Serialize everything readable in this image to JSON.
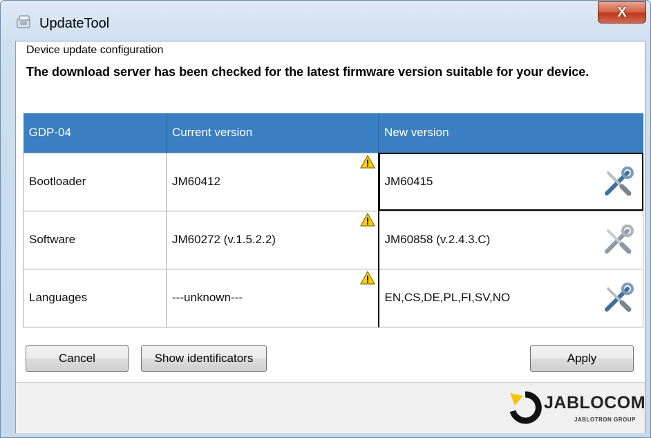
{
  "window": {
    "title": "UpdateTool",
    "close_label": "X"
  },
  "group": {
    "label": "Device update configuration",
    "headline": "The download server has been checked for the latest firmware version suitable for your device."
  },
  "table": {
    "headers": [
      "GDP-04",
      "Current version",
      "New version"
    ],
    "rows": [
      {
        "name": "Bootloader",
        "current": "JM60412",
        "new": "JM60415"
      },
      {
        "name": "Software",
        "current": "JM60272 (v.1.5.2.2)",
        "new": "JM60858 (v.2.4.3.C)"
      },
      {
        "name": "Languages",
        "current": "---unknown---",
        "new": "EN,CS,DE,PL,FI,SV,NO"
      }
    ]
  },
  "buttons": {
    "cancel": "Cancel",
    "show_identificators": "Show identificators",
    "apply": "Apply"
  },
  "logo": {
    "main": "JABLOCOM",
    "sub": "JABLOTRON GROUP"
  },
  "icons": {
    "warning": "warning-icon",
    "settings": "wrench-screwdriver-icon",
    "app": "updatetool-app-icon"
  },
  "colors": {
    "header_bg": "#3a7fc1",
    "close_red": "#c0391f",
    "logo_yellow": "#f5c400"
  }
}
